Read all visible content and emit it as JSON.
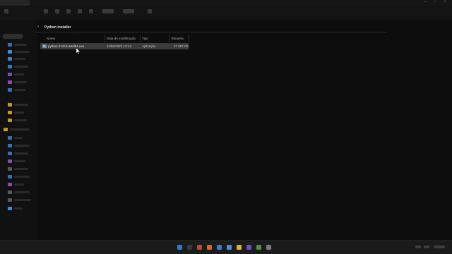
{
  "breadcrumb": {
    "folder": "Python installer"
  },
  "columns": {
    "name": "Nome",
    "date": "Data de modificação",
    "type": "Tipo",
    "size": "Tamanho"
  },
  "files": [
    {
      "name": "python-3.10.5-amd64.exe",
      "date": "11/06/2022 12:14",
      "type": "Aplicação",
      "size": "27 887 KB",
      "icon": "python-installer-icon"
    }
  ],
  "colors": {
    "background": "#0d0d0d",
    "selected_row": "#3b3b3b",
    "taskbar": "#1b1b1b"
  }
}
